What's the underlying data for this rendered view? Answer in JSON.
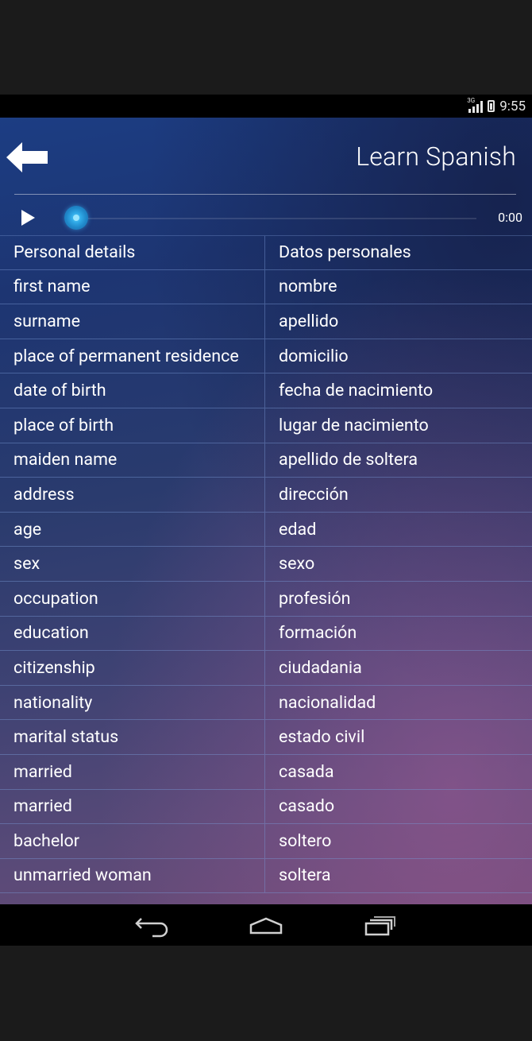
{
  "status_bar": {
    "network": "3G",
    "time": "9:55"
  },
  "header": {
    "title": "Learn Spanish"
  },
  "player": {
    "elapsed": "0:00",
    "progress": 0
  },
  "table": {
    "rows": [
      {
        "en": "Personal details",
        "es": "Datos personales"
      },
      {
        "en": "first name",
        "es": "nombre"
      },
      {
        "en": "surname",
        "es": "apellido"
      },
      {
        "en": "place of permanent residence",
        "es": "domicilio"
      },
      {
        "en": "date of birth",
        "es": "fecha de nacimiento"
      },
      {
        "en": "place of birth",
        "es": "lugar de nacimiento"
      },
      {
        "en": "maiden name",
        "es": "apellido de soltera"
      },
      {
        "en": "address",
        "es": "dirección"
      },
      {
        "en": "age",
        "es": "edad"
      },
      {
        "en": "sex",
        "es": "sexo"
      },
      {
        "en": "occupation",
        "es": "profesión"
      },
      {
        "en": "education",
        "es": "formación"
      },
      {
        "en": "citizenship",
        "es": "ciudadania"
      },
      {
        "en": "nationality",
        "es": "nacionalidad"
      },
      {
        "en": "marital status",
        "es": "estado civil"
      },
      {
        "en": "married",
        "es": "casada"
      },
      {
        "en": "married",
        "es": "casado"
      },
      {
        "en": "bachelor",
        "es": "soltero"
      },
      {
        "en": "unmarried woman",
        "es": "soltera"
      }
    ]
  },
  "icons": {
    "back": "back-arrow-icon",
    "play": "play-icon",
    "nav_back": "nav-back-icon",
    "nav_home": "nav-home-icon",
    "nav_recents": "nav-recents-icon"
  },
  "colors": {
    "accent": "#2fa8e6",
    "header_bg": "#1c3d83"
  }
}
